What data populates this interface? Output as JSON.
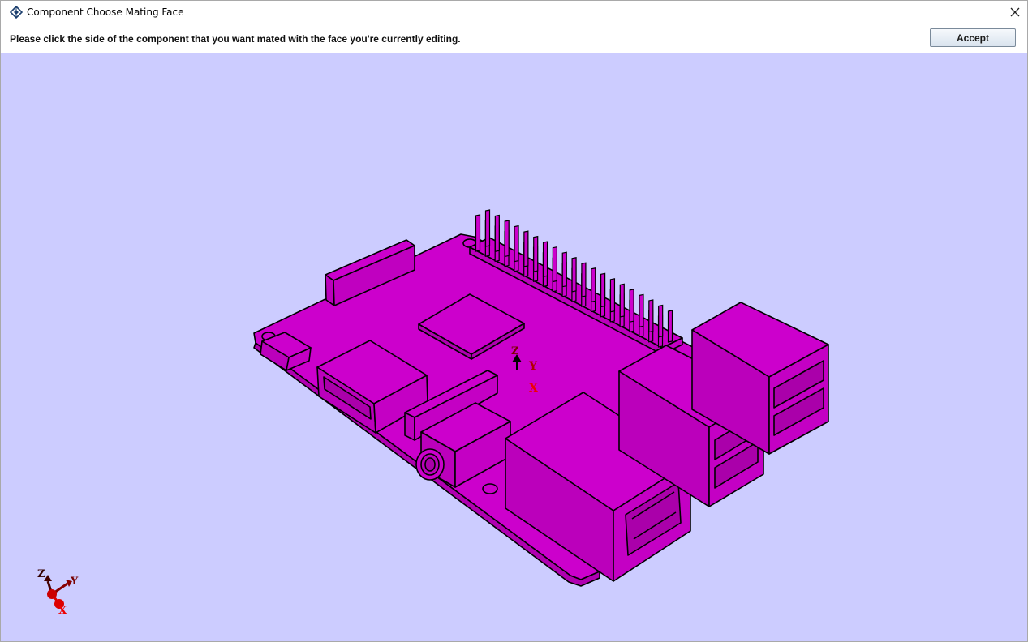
{
  "window": {
    "title": "Component Choose Mating Face"
  },
  "toolbar": {
    "instruction": "Please click the side of the component that you want mated with the face you're currently editing.",
    "accept_label": "Accept"
  },
  "viewport": {
    "background": "#ccccff",
    "model_color": "#cc00cc",
    "axis_labels": {
      "z": "Z",
      "y": "Y",
      "x": "X"
    },
    "triad_labels": {
      "z": "Z",
      "y": "Y",
      "x": "X"
    }
  },
  "icons": {
    "app": "app-icon",
    "close": "close-icon"
  }
}
